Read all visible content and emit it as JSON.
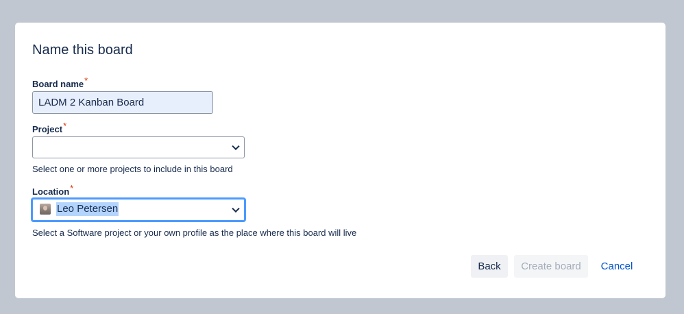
{
  "dialog": {
    "title": "Name this board",
    "board_name": {
      "label": "Board name",
      "required_mark": "*",
      "value": "LADM 2 Kanban Board"
    },
    "project": {
      "label": "Project",
      "required_mark": "*",
      "value": "",
      "help": "Select one or more projects to include in this board"
    },
    "location": {
      "label": "Location",
      "required_mark": "*",
      "value": "Leo Petersen",
      "help": "Select a Software project or your own profile as the place where this board will live"
    },
    "buttons": {
      "back": "Back",
      "create": "Create board",
      "cancel": "Cancel"
    }
  },
  "colors": {
    "overlay": "#c1c7d0",
    "link": "#0052cc",
    "required": "#de350b",
    "focus": "#4c9aff"
  },
  "icons": {
    "select_chevron": "chevron-down-icon",
    "avatar": "user-avatar-icon"
  }
}
